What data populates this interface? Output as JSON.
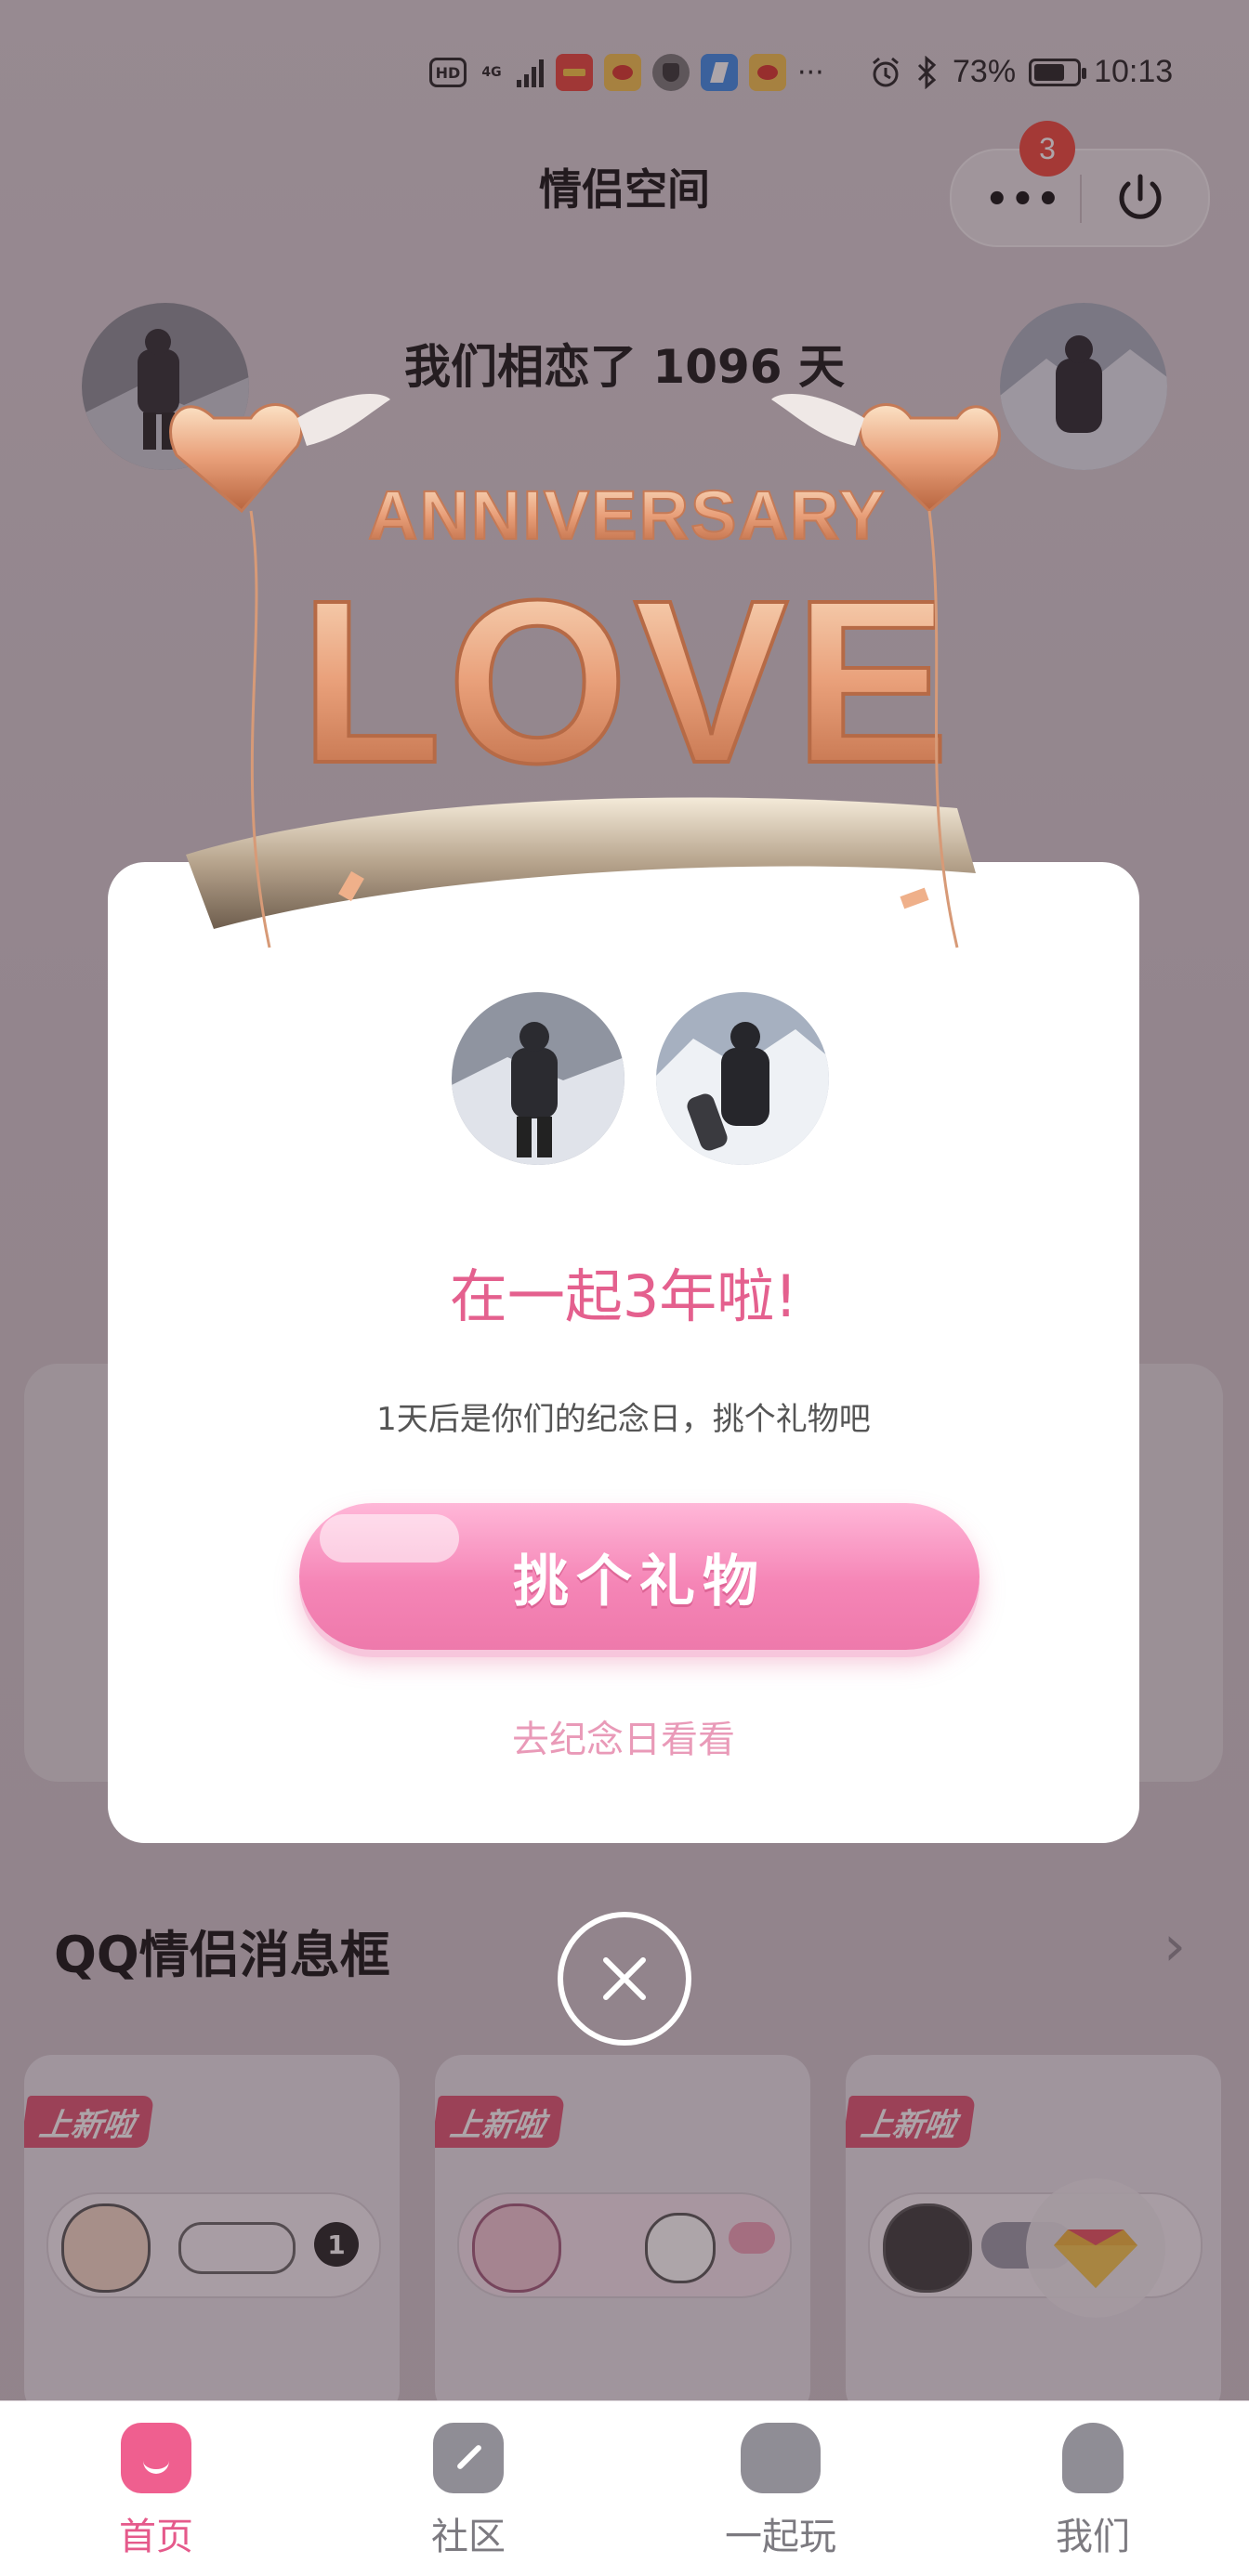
{
  "status_bar": {
    "left_icons": [
      "HD",
      "4G",
      "signal-icon",
      "app-icon-1",
      "weibo-icon",
      "shield-icon",
      "bluetooth-app-icon",
      "weibo-icon-2"
    ],
    "more": "···",
    "battery_percent": "73%",
    "battery_level": 0.73,
    "time": "10:13"
  },
  "header": {
    "title": "情侣空间",
    "badge_count": "3"
  },
  "love_days": "我们相恋了 1096 天",
  "art": {
    "banner_text": "ANNIVERSARY",
    "big_text": "LOVE"
  },
  "modal": {
    "title": "在一起3年啦!",
    "subtitle": "1天后是你们的纪念日，挑个礼物吧",
    "button_label": "挑个礼物",
    "link_label": "去纪念日看看"
  },
  "section": {
    "title": "QQ情侣消息框"
  },
  "cards": [
    {
      "tag": "上新啦"
    },
    {
      "tag": "上新啦"
    },
    {
      "tag": "上新啦"
    }
  ],
  "tabs": [
    {
      "label": "首页",
      "icon": "home-icon",
      "active": true
    },
    {
      "label": "社区",
      "icon": "feather-icon",
      "active": false
    },
    {
      "label": "一起玩",
      "icon": "gamepad-icon",
      "active": false
    },
    {
      "label": "我们",
      "icon": "couple-icon",
      "active": false
    }
  ],
  "colors": {
    "accent": "#e4608e",
    "button": "#f585b6",
    "badge": "#f0453a",
    "tag": "#e05372"
  }
}
